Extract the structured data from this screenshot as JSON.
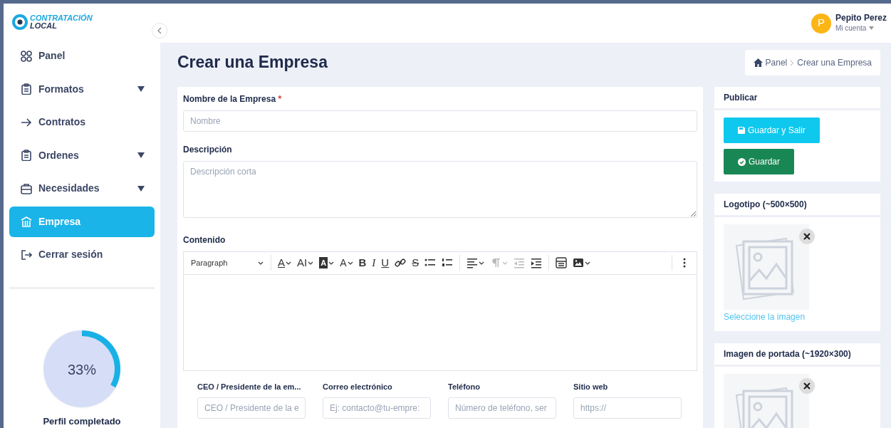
{
  "logo": {
    "line1": "CONTRATACIÓN",
    "line2": "LOCAL"
  },
  "sidebar": {
    "items": [
      {
        "label": "Panel",
        "kind": "grid",
        "has_submenu": false,
        "selected": false
      },
      {
        "label": "Formatos",
        "kind": "clipboard",
        "has_submenu": true,
        "selected": false
      },
      {
        "label": "Contratos",
        "kind": "arrow",
        "has_submenu": false,
        "selected": false
      },
      {
        "label": "Ordenes",
        "kind": "clipboard",
        "has_submenu": true,
        "selected": false
      },
      {
        "label": "Necesidades",
        "kind": "briefcase",
        "has_submenu": true,
        "selected": false
      },
      {
        "label": "Empresa",
        "kind": "building",
        "has_submenu": false,
        "selected": true
      },
      {
        "label": "Cerrar sesión",
        "kind": "logout",
        "has_submenu": false,
        "selected": false
      }
    ],
    "profile": {
      "percent": "33%",
      "level": 0.33,
      "caption": "Perfil completado"
    }
  },
  "user": {
    "initial": "P",
    "name": "Pepito Perez",
    "menu": "Mi cuenta"
  },
  "page_title": "Crear una Empresa",
  "breadcrumb": [
    "Panel",
    "Crear una Empresa"
  ],
  "form": {
    "name_label": "Nombre de la Empresa",
    "name_required": "*",
    "name_placeholder": "Nombre",
    "description_label": "Descripción",
    "description_placeholder": "Descripción corta",
    "content_label": "Contenido",
    "editor": {
      "paragraph": "Paragraph",
      "groups": [
        [
          {
            "kind": "font-color",
            "label": "A",
            "dropdown": true
          },
          {
            "kind": "font-size",
            "label": "AI",
            "dropdown": true
          },
          {
            "kind": "highlight",
            "label": "A",
            "dropdown": true
          },
          {
            "kind": "style",
            "label": "A",
            "dropdown": true
          },
          {
            "kind": "bold",
            "label": "B"
          },
          {
            "kind": "italic",
            "label": "I"
          },
          {
            "kind": "underline",
            "label": "U"
          },
          {
            "kind": "link"
          },
          {
            "kind": "strike",
            "label": "S"
          },
          {
            "kind": "bullets"
          },
          {
            "kind": "numbers"
          }
        ],
        [
          {
            "kind": "align",
            "dropdown": true
          },
          {
            "kind": "pilcrow",
            "dropdown": true,
            "disabled": true
          },
          {
            "kind": "outdent",
            "disabled": true
          },
          {
            "kind": "indent"
          }
        ],
        [
          {
            "kind": "html"
          },
          {
            "kind": "image",
            "dropdown": true
          }
        ],
        [
          {
            "kind": "more"
          }
        ]
      ]
    },
    "fields": [
      {
        "label": "CEO / Presidente de la em...",
        "placeholder": "CEO / Presidente de la e"
      },
      {
        "label": "Correo electrónico",
        "placeholder": "Ej: contacto@tu-empre:"
      },
      {
        "label": "Teléfono",
        "placeholder": "Número de teléfono, ser"
      },
      {
        "label": "Sitio web",
        "placeholder": "https://"
      }
    ]
  },
  "publish": {
    "title": "Publicar",
    "save_exit": "Guardar y Salir",
    "save": "Guardar"
  },
  "images": [
    {
      "title": "Logotipo (~500×500)",
      "link": "Seleccione la imagen"
    },
    {
      "title": "Imagen de portada (~1920×300)"
    }
  ]
}
